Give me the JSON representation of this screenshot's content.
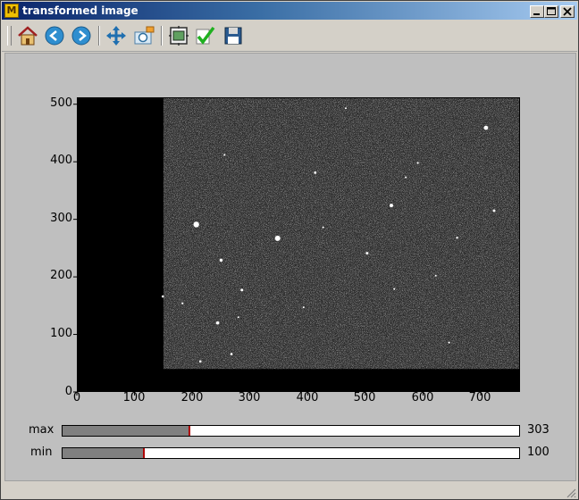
{
  "window": {
    "title": "transformed image",
    "app_icon": "matplotlib-icon",
    "controls": [
      "minimize-icon",
      "maximize-icon",
      "close-icon"
    ]
  },
  "toolbar": {
    "buttons": [
      {
        "name": "home-button",
        "icon": "home-icon"
      },
      {
        "name": "back-button",
        "icon": "back-arrow-icon"
      },
      {
        "name": "forward-button",
        "icon": "forward-arrow-icon"
      },
      {
        "name": "pan-button",
        "icon": "pan-move-icon"
      },
      {
        "name": "zoom-button",
        "icon": "zoom-rect-icon"
      },
      {
        "name": "subplots-button",
        "icon": "subplots-config-icon"
      },
      {
        "name": "edit-button",
        "icon": "checkmark-icon"
      },
      {
        "name": "save-button",
        "icon": "floppy-save-icon"
      }
    ]
  },
  "plot": {
    "x_ticks": [
      "0",
      "100",
      "200",
      "300",
      "400",
      "500",
      "600",
      "700"
    ],
    "y_ticks": [
      "0",
      "100",
      "200",
      "300",
      "400",
      "500"
    ],
    "xlim": [
      0,
      768
    ],
    "ylim": [
      0,
      512
    ],
    "image_extent": {
      "x": [
        150,
        770
      ],
      "y": [
        40,
        512
      ]
    },
    "colors": {
      "background": "#000000",
      "noise": "#2a2a2a",
      "figure": "#bfbfbf"
    },
    "stars": [
      {
        "x": 207,
        "y": 291,
        "r": 3.2
      },
      {
        "x": 348,
        "y": 267,
        "r": 3.0
      },
      {
        "x": 709,
        "y": 459,
        "r": 2.4
      },
      {
        "x": 545,
        "y": 324,
        "r": 2.0
      },
      {
        "x": 250,
        "y": 229,
        "r": 1.8
      },
      {
        "x": 244,
        "y": 120,
        "r": 1.8
      },
      {
        "x": 286,
        "y": 177,
        "r": 1.5
      },
      {
        "x": 503,
        "y": 241,
        "r": 1.5
      },
      {
        "x": 413,
        "y": 381,
        "r": 1.4
      },
      {
        "x": 723,
        "y": 315,
        "r": 1.5
      },
      {
        "x": 268,
        "y": 66,
        "r": 1.3
      },
      {
        "x": 214,
        "y": 53,
        "r": 1.3
      },
      {
        "x": 149,
        "y": 166,
        "r": 1.3
      },
      {
        "x": 183,
        "y": 154,
        "r": 1.1
      },
      {
        "x": 591,
        "y": 398,
        "r": 1.1
      },
      {
        "x": 570,
        "y": 373,
        "r": 1.0
      },
      {
        "x": 256,
        "y": 412,
        "r": 1.0
      },
      {
        "x": 659,
        "y": 268,
        "r": 1.2
      },
      {
        "x": 645,
        "y": 86,
        "r": 1.0
      },
      {
        "x": 427,
        "y": 286,
        "r": 1.0
      },
      {
        "x": 280,
        "y": 130,
        "r": 1.0
      },
      {
        "x": 622,
        "y": 202,
        "r": 1.0
      },
      {
        "x": 550,
        "y": 179,
        "r": 1.0
      },
      {
        "x": 466,
        "y": 493,
        "r": 1.0
      },
      {
        "x": 393,
        "y": 147,
        "r": 1.0
      }
    ]
  },
  "sliders": [
    {
      "label": "max",
      "value": "303",
      "fraction": 0.28
    },
    {
      "label": "min",
      "value": "100",
      "fraction": 0.18
    }
  ]
}
